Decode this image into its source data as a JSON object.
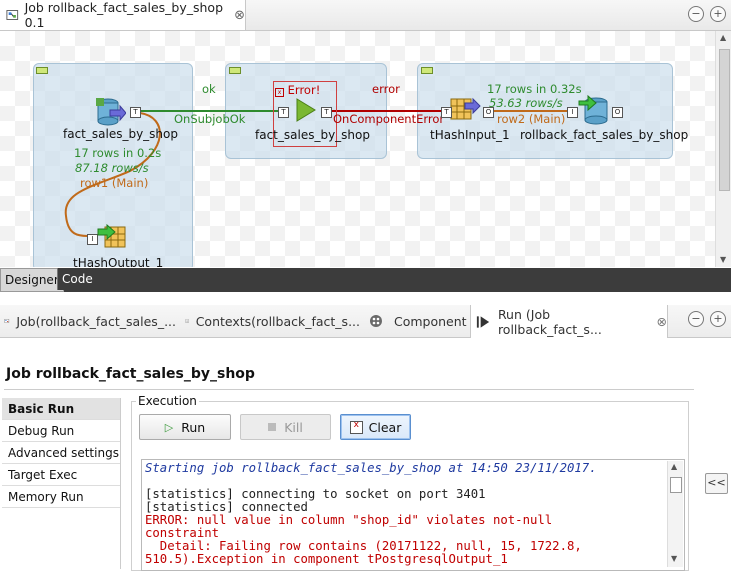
{
  "editor_tab": {
    "title": "Job rollback_fact_sales_by_shop 0.1",
    "close": "⊗"
  },
  "window_controls": {
    "minimize": "−",
    "maximize": "+"
  },
  "canvas": {
    "components": {
      "source": {
        "label": "fact_sales_by_shop"
      },
      "dbrow": {
        "label": "fact_sales_by_shop",
        "error_badge": "Error!"
      },
      "hash_input": {
        "label": "tHashInput_1"
      },
      "target": {
        "label": "rollback_fact_sales_by_shop"
      },
      "hash_output": {
        "label": "tHashOutput_1"
      }
    },
    "connections": {
      "ok_top": "ok",
      "on_subjob_ok": "OnSubjobOk",
      "error_top": "error",
      "on_component_error": "OnComponentError",
      "row1_stats_rows": "17 rows in 0.2s",
      "row1_stats_rate": "87.18 rows/s",
      "row1_label": "row1 (Main)",
      "row2_stats_rows": "17 rows in 0.32s",
      "row2_stats_rate": "53.63 rows/s",
      "row2_label": "row2 (Main)"
    },
    "badge_letters": {
      "trigger": "T",
      "output": "O",
      "input": "I"
    }
  },
  "mode_tabs": {
    "designer": "Designer",
    "code": "Code"
  },
  "views": {
    "tabs": [
      {
        "label": "Job(rollback_fact_sales_..."
      },
      {
        "label": "Contexts(rollback_fact_s..."
      },
      {
        "label": "Component"
      },
      {
        "label": "Run (Job rollback_fact_s..."
      }
    ],
    "close": "⊗"
  },
  "run_panel": {
    "title": "Job rollback_fact_sales_by_shop",
    "nav": [
      "Basic Run",
      "Debug Run",
      "Advanced settings",
      "Target Exec",
      "Memory Run"
    ],
    "execution_label": "Execution",
    "buttons": {
      "run": "Run",
      "kill": "Kill",
      "clear": "Clear"
    },
    "collapse": "<<"
  },
  "console": {
    "lines": [
      "Starting job rollback_fact_sales_by_shop at 14:50 23/11/2017.",
      "",
      "[statistics] connecting to socket on port 3401",
      "[statistics] connected",
      "ERROR: null value in column \"shop_id\" violates not-null",
      "constraint",
      "  Detail: Failing row contains (20171122, null, 15, 1722.8,",
      "510.5).Exception in component tPostgresqlOutput_1"
    ]
  },
  "colors": {
    "ok_link": "#2e8b2e",
    "error_link": "#b00000",
    "row_link": "#c06a1a",
    "subjob_bg": "#c8dceb"
  }
}
